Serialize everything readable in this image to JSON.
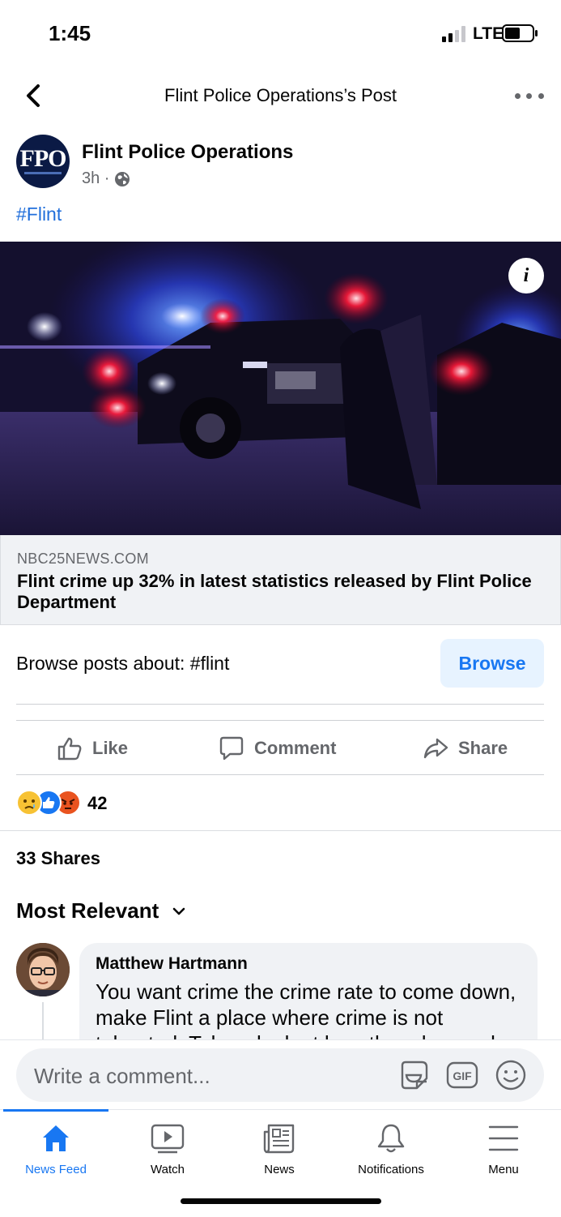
{
  "status_bar": {
    "time": "1:45",
    "network": "LTE"
  },
  "header": {
    "title": "Flint Police Operations’s Post"
  },
  "post": {
    "author": "Flint Police Operations",
    "avatar_text": "FPO",
    "time": "3h ·",
    "hashtag": "#Flint",
    "link": {
      "domain": "NBC25NEWS.COM",
      "title": "Flint crime up 32% in latest statistics released by Flint Police Department"
    },
    "browse_text": "Browse posts about: #flint",
    "browse_label": "Browse",
    "actions": {
      "like": "Like",
      "comment": "Comment",
      "share": "Share"
    },
    "reactions": {
      "icons": [
        "sad-icon",
        "like-icon",
        "angry-icon"
      ],
      "count": "42"
    },
    "shares": "33 Shares",
    "sort_label": "Most Relevant"
  },
  "comments": [
    {
      "author": "Matthew Hartmann",
      "text": "You want crime the crime rate to come down, make Flint a place where crime is not tolerated. Take a look at how they do people"
    }
  ],
  "composer": {
    "placeholder": "Write a comment..."
  },
  "tabs": [
    {
      "label": "News Feed",
      "icon": "home-icon"
    },
    {
      "label": "Watch",
      "icon": "watch-icon"
    },
    {
      "label": "News",
      "icon": "news-icon"
    },
    {
      "label": "Notifications",
      "icon": "bell-icon"
    },
    {
      "label": "Menu",
      "icon": "menu-icon"
    }
  ],
  "colors": {
    "accent": "#1877f2",
    "link": "#216fdb",
    "secondary_text": "#65676b"
  }
}
